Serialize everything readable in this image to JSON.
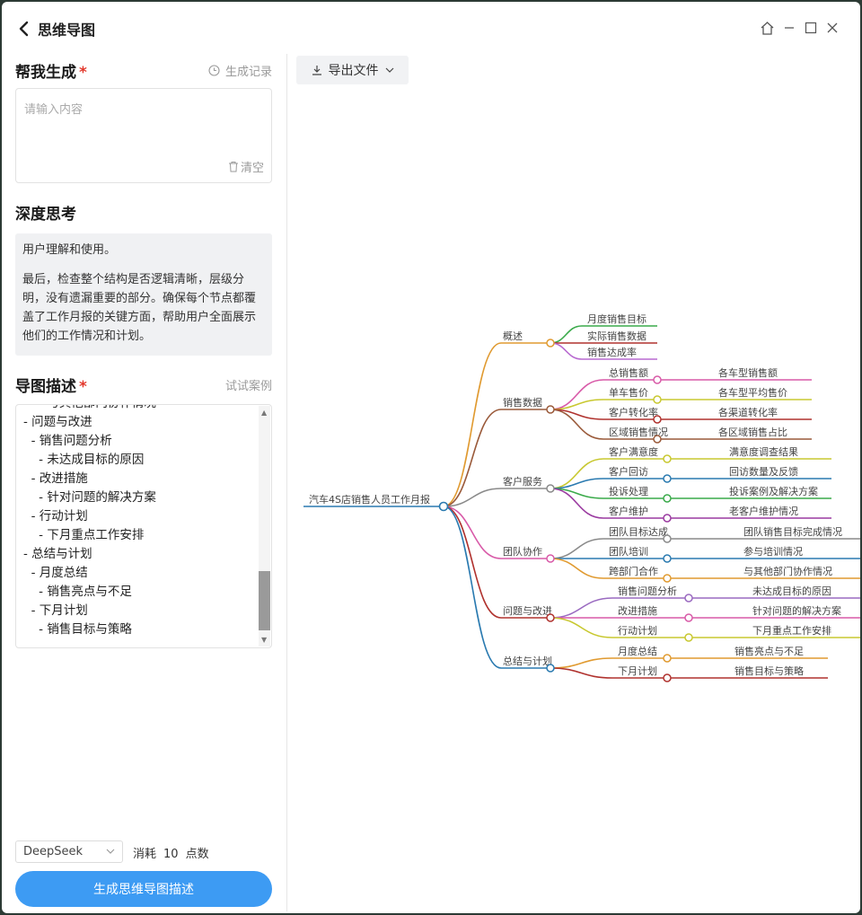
{
  "title": "思维导图",
  "left": {
    "help_title": "帮我生成",
    "required_mark": "*",
    "history_label": "生成记录",
    "input_placeholder": "请输入内容",
    "clear_label": "清空",
    "deep_think_title": "深度思考",
    "deep_think_paragraphs": [
      "用户理解和使用。",
      "最后，检查整个结构是否逻辑清晰，层级分明，没有遗漏重要的部分。确保每个节点都覆盖了工作月报的关键方面，帮助用户全面展示他们的工作情况和计划。"
    ],
    "desc_title": "导图描述",
    "try_case_label": "试试案例",
    "desc_lines": [
      "    - 与其他部门协作情况",
      "- 问题与改进",
      "  - 销售问题分析",
      "    - 未达成目标的原因",
      "  - 改进措施",
      "    - 针对问题的解决方案",
      "  - 行动计划",
      "    - 下月重点工作安排",
      "- 总结与计划",
      "  - 月度总结",
      "    - 销售亮点与不足",
      "  - 下月计划",
      "    - 销售目标与策略"
    ],
    "model": "DeepSeek",
    "cost_prefix": "消耗",
    "cost_value": "10",
    "cost_suffix": "点数",
    "generate_label": "生成思维导图描述"
  },
  "toolbar": {
    "export_label": "导出文件"
  },
  "mindmap": {
    "root": "汽车4S店销售人员工作月报",
    "branches": [
      {
        "label": "概述",
        "color": "#e09a30",
        "children": [
          {
            "label": "月度销售目标",
            "color": "#3aaa4a"
          },
          {
            "label": "实际销售数据",
            "color": "#b0322e"
          },
          {
            "label": "销售达成率",
            "color": "#b86ad0"
          }
        ]
      },
      {
        "label": "销售数据",
        "color": "#9a5a3a",
        "children": [
          {
            "label": "总销售额",
            "color": "#d85aa8",
            "leaf": "各车型销售额"
          },
          {
            "label": "单车售价",
            "color": "#c8c830",
            "leaf": "各车型平均售价"
          },
          {
            "label": "客户转化率",
            "color": "#b0322e",
            "leaf": "各渠道转化率"
          },
          {
            "label": "区域销售情况",
            "color": "#9a5a3a",
            "leaf": "各区域销售占比"
          }
        ]
      },
      {
        "label": "客户服务",
        "color": "#8a8a8a",
        "children": [
          {
            "label": "客户满意度",
            "color": "#c8c830",
            "leaf": "满意度调查结果"
          },
          {
            "label": "客户回访",
            "color": "#2a7ab0",
            "leaf": "回访数量及反馈"
          },
          {
            "label": "投诉处理",
            "color": "#3aaa4a",
            "leaf": "投诉案例及解决方案"
          },
          {
            "label": "客户维护",
            "color": "#9a3aa0",
            "leaf": "老客户维护情况"
          }
        ]
      },
      {
        "label": "团队协作",
        "color": "#d85aa8",
        "children": [
          {
            "label": "团队目标达成",
            "color": "#8a8a8a",
            "leaf": "团队销售目标完成情况"
          },
          {
            "label": "团队培训",
            "color": "#2a7ab0",
            "leaf": "参与培训情况"
          },
          {
            "label": "跨部门合作",
            "color": "#e09a30",
            "leaf": "与其他部门协作情况"
          }
        ]
      },
      {
        "label": "问题与改进",
        "color": "#b0322e",
        "children": [
          {
            "label": "销售问题分析",
            "color": "#9a6ac0",
            "leaf": "未达成目标的原因"
          },
          {
            "label": "改进措施",
            "color": "#d85aa8",
            "leaf": "针对问题的解决方案"
          },
          {
            "label": "行动计划",
            "color": "#c8c830",
            "leaf": "下月重点工作安排"
          }
        ]
      },
      {
        "label": "总结与计划",
        "color": "#2a7ab0",
        "children": [
          {
            "label": "月度总结",
            "color": "#e09a30",
            "leaf": "销售亮点与不足"
          },
          {
            "label": "下月计划",
            "color": "#b0322e",
            "leaf": "销售目标与策略"
          }
        ]
      }
    ]
  }
}
